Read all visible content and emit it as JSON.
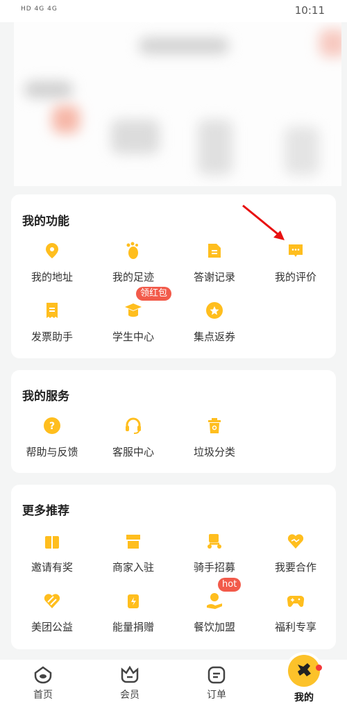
{
  "status_bar": {
    "left": "HD 4G 4G",
    "time": "10:11"
  },
  "colors": {
    "accent": "#FFBE1E",
    "badge": "#F25A4A",
    "arrow": "#E81010"
  },
  "my_functions": {
    "title": "我的功能",
    "items": [
      {
        "label": "我的地址",
        "icon": "location-pin-icon"
      },
      {
        "label": "我的足迹",
        "icon": "footprint-icon"
      },
      {
        "label": "答谢记录",
        "icon": "document-icon"
      },
      {
        "label": "我的评价",
        "icon": "comment-bubble-icon"
      },
      {
        "label": "发票助手",
        "icon": "receipt-icon"
      },
      {
        "label": "学生中心",
        "icon": "graduation-cap-icon",
        "badge": "领红包"
      },
      {
        "label": "集点返券",
        "icon": "star-coin-icon"
      }
    ]
  },
  "my_services": {
    "title": "我的服务",
    "items": [
      {
        "label": "帮助与反馈",
        "icon": "question-icon"
      },
      {
        "label": "客服中心",
        "icon": "headset-icon"
      },
      {
        "label": "垃圾分类",
        "icon": "trash-bin-icon"
      }
    ]
  },
  "more": {
    "title": "更多推荐",
    "items": [
      {
        "label": "邀请有奖",
        "icon": "gift-icon"
      },
      {
        "label": "商家入驻",
        "icon": "store-icon"
      },
      {
        "label": "骑手招募",
        "icon": "scooter-icon"
      },
      {
        "label": "我要合作",
        "icon": "heart-handshake-icon"
      },
      {
        "label": "美团公益",
        "icon": "charity-icon"
      },
      {
        "label": "能量捐赠",
        "icon": "energy-icon"
      },
      {
        "label": "餐饮加盟",
        "icon": "franchise-icon",
        "badge": "hot"
      },
      {
        "label": "福利专享",
        "icon": "gamepad-icon"
      }
    ]
  },
  "tabbar": {
    "items": [
      {
        "label": "首页"
      },
      {
        "label": "会员"
      },
      {
        "label": "订单"
      },
      {
        "label": "我的",
        "active": true
      }
    ]
  }
}
